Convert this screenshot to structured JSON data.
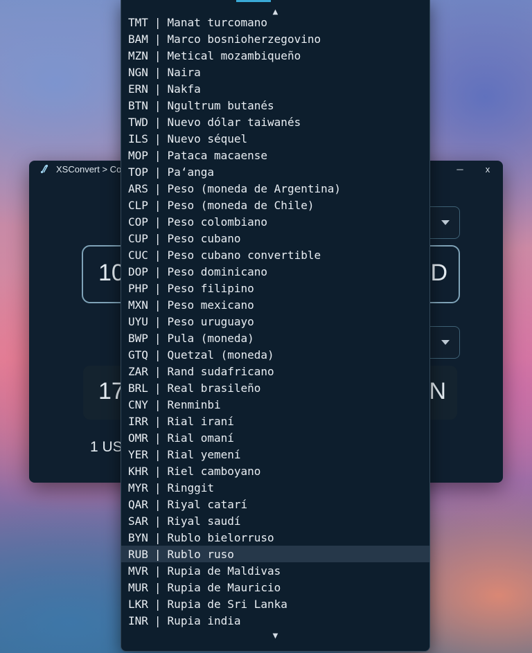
{
  "app": {
    "title": "XSConvert > Co",
    "minimize_glyph": "─",
    "close_glyph": "x"
  },
  "converter": {
    "amount_partial": "10",
    "from_currency_partial": "D",
    "result_partial": "17",
    "to_currency_partial": "N",
    "rate_partial": "1 US"
  },
  "dropdown": {
    "scroll_up_glyph": "▲",
    "scroll_down_glyph": "▼",
    "separator": "|",
    "selected_code": "RUB",
    "options": [
      {
        "code": "TMT",
        "name": "Manat turcomano"
      },
      {
        "code": "BAM",
        "name": "Marco bosnioherzegovino"
      },
      {
        "code": "MZN",
        "name": "Metical mozambiqueño"
      },
      {
        "code": "NGN",
        "name": "Naira"
      },
      {
        "code": "ERN",
        "name": "Nakfa"
      },
      {
        "code": "BTN",
        "name": "Ngultrum butanés"
      },
      {
        "code": "TWD",
        "name": "Nuevo dólar taiwanés"
      },
      {
        "code": "ILS",
        "name": "Nuevo séquel"
      },
      {
        "code": "MOP",
        "name": "Pataca macaense"
      },
      {
        "code": "TOP",
        "name": "Paʻanga"
      },
      {
        "code": "ARS",
        "name": "Peso (moneda de Argentina)"
      },
      {
        "code": "CLP",
        "name": "Peso (moneda de Chile)"
      },
      {
        "code": "COP",
        "name": "Peso colombiano"
      },
      {
        "code": "CUP",
        "name": "Peso cubano"
      },
      {
        "code": "CUC",
        "name": "Peso cubano convertible"
      },
      {
        "code": "DOP",
        "name": "Peso dominicano"
      },
      {
        "code": "PHP",
        "name": "Peso filipino"
      },
      {
        "code": "MXN",
        "name": "Peso mexicano"
      },
      {
        "code": "UYU",
        "name": "Peso uruguayo"
      },
      {
        "code": "BWP",
        "name": "Pula (moneda)"
      },
      {
        "code": "GTQ",
        "name": "Quetzal (moneda)"
      },
      {
        "code": "ZAR",
        "name": "Rand sudafricano"
      },
      {
        "code": "BRL",
        "name": "Real brasileño"
      },
      {
        "code": "CNY",
        "name": "Renminbi"
      },
      {
        "code": "IRR",
        "name": "Rial iraní"
      },
      {
        "code": "OMR",
        "name": "Rial omaní"
      },
      {
        "code": "YER",
        "name": "Rial yemení"
      },
      {
        "code": "KHR",
        "name": "Riel camboyano"
      },
      {
        "code": "MYR",
        "name": "Ringgit"
      },
      {
        "code": "QAR",
        "name": "Riyal catarí"
      },
      {
        "code": "SAR",
        "name": "Riyal saudí"
      },
      {
        "code": "BYN",
        "name": "Rublo bielorruso"
      },
      {
        "code": "RUB",
        "name": "Rublo ruso"
      },
      {
        "code": "MVR",
        "name": "Rupia de Maldivas"
      },
      {
        "code": "MUR",
        "name": "Rupia de Mauricio"
      },
      {
        "code": "LKR",
        "name": "Rupia de Sri Lanka"
      },
      {
        "code": "INR",
        "name": "Rupia india"
      }
    ]
  }
}
